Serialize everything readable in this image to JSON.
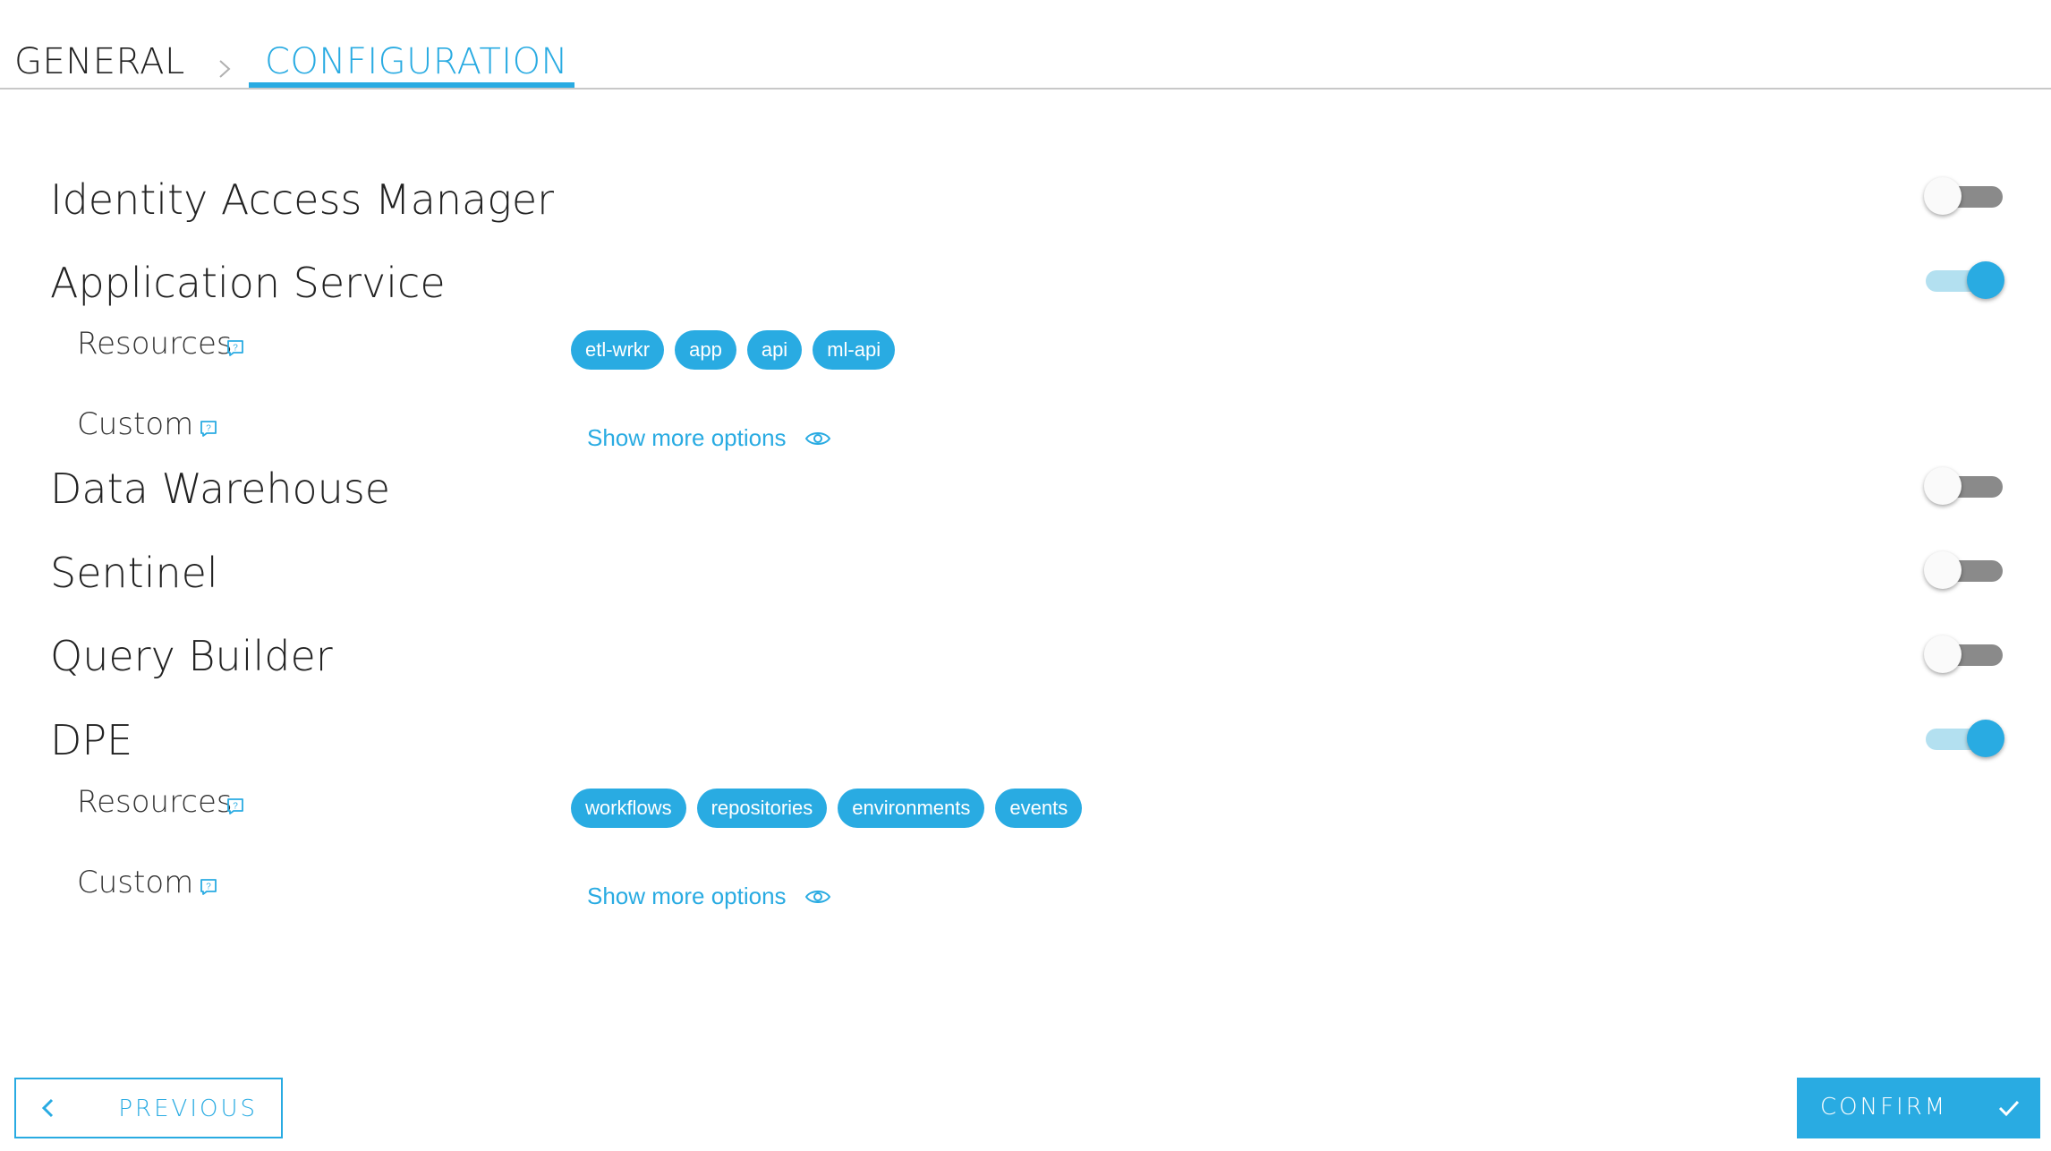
{
  "tabs": {
    "general": "GENERAL",
    "configuration": "CONFIGURATION"
  },
  "services": [
    {
      "title": "Identity Access Manager",
      "enabled": false
    },
    {
      "title": "Application Service",
      "enabled": true,
      "resources_label": "Resources",
      "custom_label": "Custom",
      "resources": [
        "etl-wrkr",
        "app",
        "api",
        "ml-api"
      ],
      "show_more": "Show more options"
    },
    {
      "title": "Data Warehouse",
      "enabled": false
    },
    {
      "title": "Sentinel",
      "enabled": false
    },
    {
      "title": "Query Builder",
      "enabled": false
    },
    {
      "title": "DPE",
      "enabled": true,
      "resources_label": "Resources",
      "custom_label": "Custom",
      "resources": [
        "workflows",
        "repositories",
        "environments",
        "events"
      ],
      "show_more": "Show more options"
    }
  ],
  "footer": {
    "previous_label": "PREVIOUS",
    "confirm_label": "CONFIRM"
  },
  "colors": {
    "accent": "#29abe2",
    "toggle_off": "#8a8a8a",
    "toggle_on_track": "#b3e0f0"
  },
  "icons": {
    "help": "help-icon",
    "eye": "eye-icon",
    "chevron_right": "chevron-right-icon",
    "chevron_left": "chevron-left-icon",
    "check": "check-icon"
  }
}
